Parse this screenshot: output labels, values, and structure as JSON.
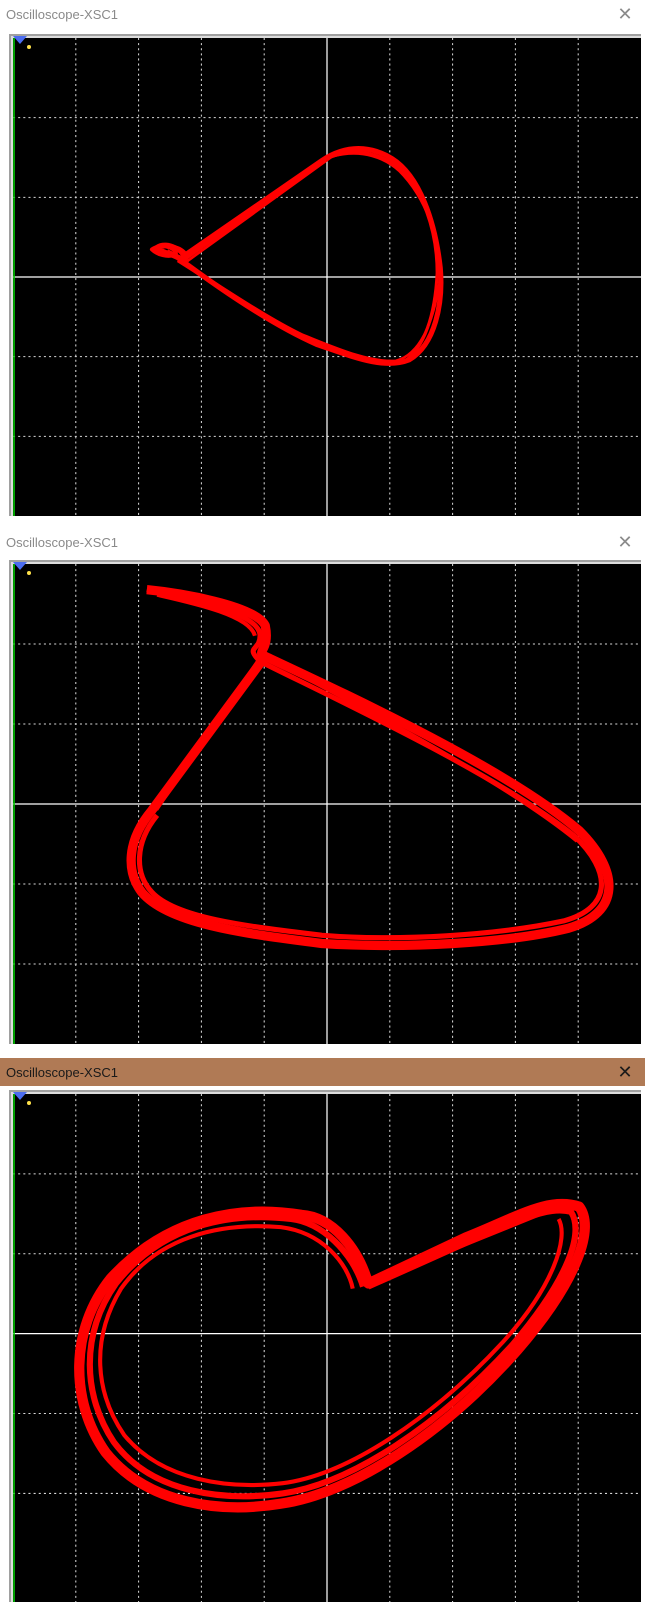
{
  "windows": [
    {
      "title": "Oscilloscope-XSC1",
      "close_label": "✕",
      "state": "inactive"
    },
    {
      "title": "Oscilloscope-XSC1",
      "close_label": "✕",
      "state": "inactive"
    },
    {
      "title": "Oscilloscope-XSC1",
      "close_label": "✕",
      "state": "active"
    }
  ],
  "colors": {
    "screen_bg": "#000000",
    "grid": "#ffffff",
    "trace": "#ff0000",
    "channel_a_line": "#00cc00",
    "active_titlebar": "#b07a55"
  },
  "chart_data": [
    {
      "type": "scatter",
      "grid": true,
      "grid_divisions": {
        "x": 10,
        "y": 6
      }
    },
    {
      "type": "scatter",
      "grid": true,
      "grid_divisions": {
        "x": 10,
        "y": 6
      }
    },
    {
      "type": "scatter",
      "grid": true,
      "grid_divisions": {
        "x": 10,
        "y": 6
      }
    }
  ]
}
